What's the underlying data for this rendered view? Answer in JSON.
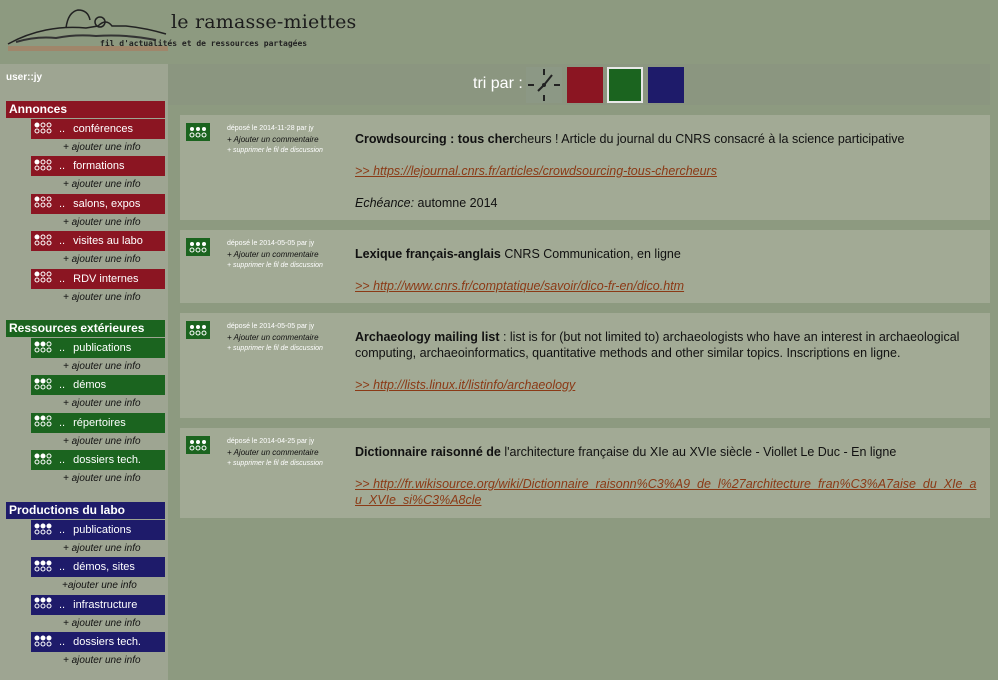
{
  "header": {
    "title": "le ramasse-miettes",
    "subtitle": "fil d'actualités et de ressources partagées"
  },
  "user": "user::jy",
  "sort": {
    "label": "tri par :",
    "options": [
      "clock-icon",
      "red",
      "green",
      "blue"
    ],
    "selected": "green"
  },
  "colors": {
    "red": "#8b1522",
    "green": "#1b641f",
    "blue": "#1e1b6a"
  },
  "sidebar": {
    "sections": [
      {
        "title": "Annonces",
        "color": "red",
        "items": [
          {
            "label": "conférences",
            "add": "+ ajouter une info"
          },
          {
            "label": "formations",
            "add": "+ ajouter une info"
          },
          {
            "label": "salons, expos",
            "add": "+ ajouter une info"
          },
          {
            "label": "visites au labo",
            "add": "+ ajouter une info"
          },
          {
            "label": "RDV internes",
            "add": "+ ajouter une info"
          }
        ]
      },
      {
        "title": "Ressources extérieures",
        "color": "green",
        "items": [
          {
            "label": "publications",
            "add": "+ ajouter une info"
          },
          {
            "label": "démos",
            "add": "+ ajouter une info"
          },
          {
            "label": "répertoires",
            "add": "+ ajouter une info"
          },
          {
            "label": "dossiers tech.",
            "add": "+ ajouter une info"
          }
        ]
      },
      {
        "title": "Productions du labo",
        "color": "blue",
        "items": [
          {
            "label": "publications",
            "add": "+ ajouter une info"
          },
          {
            "label": "démos, sites",
            "add": "+ajouter une info"
          },
          {
            "label": "infrastructure",
            "add": "+ ajouter une info"
          },
          {
            "label": "dossiers tech.",
            "add": "+ ajouter une info"
          }
        ]
      }
    ]
  },
  "posts": [
    {
      "meta": "déposé le 2014-11-28 par jy",
      "comment": "+ Ajouter un commentaire",
      "delete": "+ supprimer le fil de discussion",
      "title": "Crowdsourcing : tous cher",
      "text": "cheurs ! Article du journal du CNRS consacré à la science participative",
      "link": ">> https://lejournal.cnrs.fr/articles/crowdsourcing-tous-chercheurs",
      "extra_label": "Echéance:",
      "extra_value": " automne 2014"
    },
    {
      "meta": "déposé le 2014-05-05 par jy",
      "comment": "+ Ajouter un commentaire",
      "delete": "+ supprimer le fil de discussion",
      "title": "Lexique français-anglais",
      "text": " CNRS Communication, en ligne",
      "link": ">> http://www.cnrs.fr/comptatique/savoir/dico-fr-en/dico.htm"
    },
    {
      "meta": "déposé le 2014-05-05 par jy",
      "comment": "+ Ajouter un commentaire",
      "delete": "+ supprimer le fil de discussion",
      "title": "Archaeology mailing list",
      "text": " : list is for (but not limited to) archaeologists who have an interest in archaeological computing, archaeoinformatics, quantitative methods and other similar topics. Inscriptions en ligne.",
      "link": ">> http://lists.linux.it/listinfo/archaeology"
    },
    {
      "meta": "déposé le 2014-04-25 par jy",
      "comment": "+ Ajouter un commentaire",
      "delete": "+ supprimer le fil de discussion",
      "title": "Dictionnaire raisonné de",
      "text": " l'architecture française du XIe au XVIe siècle - Viollet Le Duc - En ligne",
      "link": ">> http://fr.wikisource.org/wiki/Dictionnaire_raisonn%C3%A9_de_l%27architecture_fran%C3%A7aise_du_XIe_au_XVIe_si%C3%A8cle"
    }
  ]
}
